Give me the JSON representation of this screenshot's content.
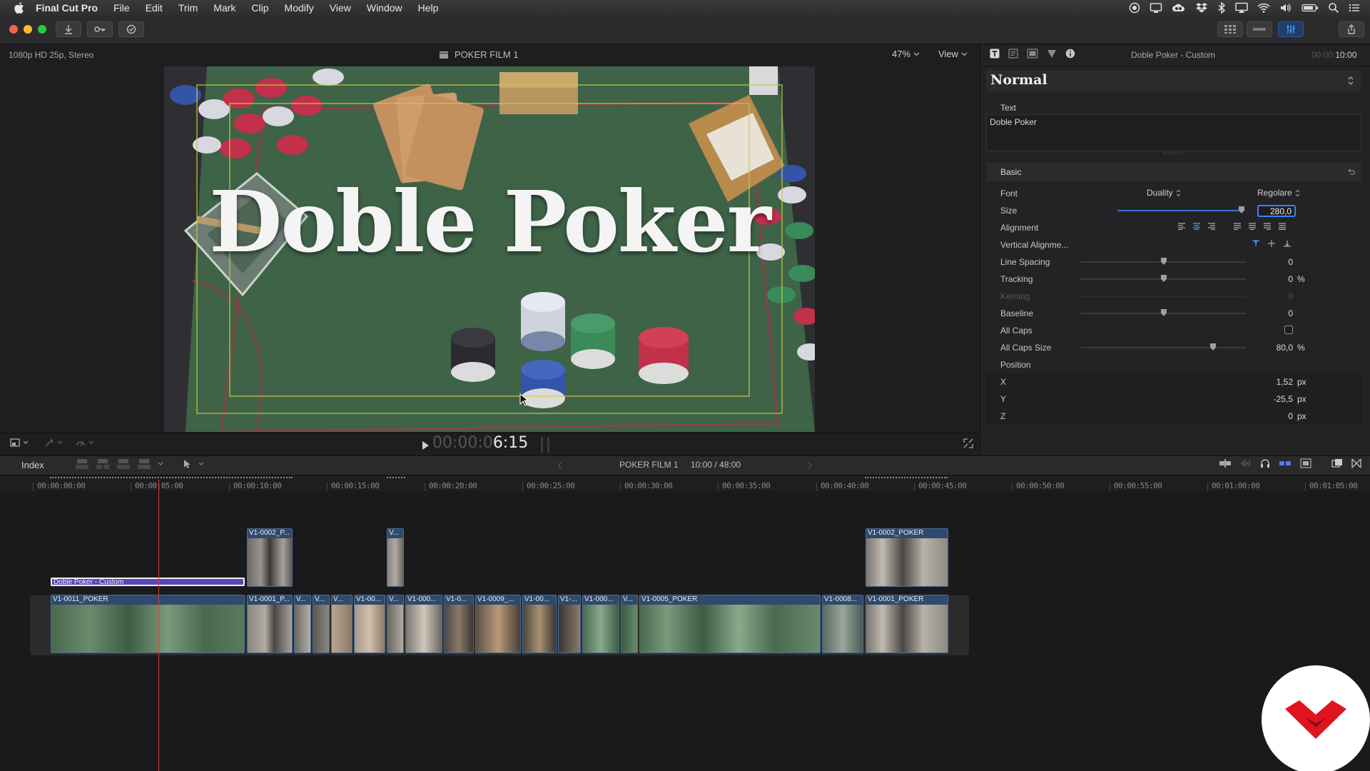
{
  "menubar": {
    "app_name": "Final Cut Pro",
    "items": [
      "File",
      "Edit",
      "Trim",
      "Mark",
      "Clip",
      "Modify",
      "View",
      "Window",
      "Help"
    ],
    "status_icons": [
      "record-icon",
      "display-icon",
      "creative-cloud-icon",
      "dropbox-icon",
      "bluetooth-icon",
      "airplay-icon",
      "wifi-icon",
      "volume-icon",
      "battery-icon",
      "spotlight-icon",
      "notification-center-icon"
    ]
  },
  "viewer": {
    "format": "1080p HD 25p, Stereo",
    "project_title": "POKER FILM 1",
    "zoom": "47%",
    "view_label": "View",
    "title_text": "Doble Poker",
    "timecode_dim": "00:00:0",
    "timecode_bright": "6:15"
  },
  "inspector": {
    "header_title": "Doble Poker - Custom",
    "header_time_dim": "00:00:",
    "header_time": "10:00",
    "style_preset": "Normal",
    "text_section_label": "Text",
    "text_value": "Doble Poker",
    "basic_label": "Basic",
    "rows": {
      "font_label": "Font",
      "font_value": "Duality",
      "font_style": "Regolare",
      "size_label": "Size",
      "size_value": "280,0",
      "alignment_label": "Alignment",
      "valign_label": "Vertical Alignme...",
      "line_spacing_label": "Line Spacing",
      "line_spacing_value": "0",
      "tracking_label": "Tracking",
      "tracking_value": "0",
      "tracking_unit": "%",
      "kerning_label": "Kerning",
      "kerning_value": "0",
      "baseline_label": "Baseline",
      "baseline_value": "0",
      "all_caps_label": "All Caps",
      "all_caps_size_label": "All Caps Size",
      "all_caps_size_value": "80,0",
      "all_caps_size_unit": "%",
      "position_label": "Position",
      "x_label": "X",
      "x_value": "1,52",
      "x_unit": "px",
      "y_label": "Y",
      "y_value": "-25,5",
      "y_unit": "px",
      "z_label": "Z",
      "z_value": "0",
      "z_unit": "px"
    }
  },
  "timeline": {
    "index_label": "Index",
    "project_name": "POKER FILM 1",
    "duration": "10:00 / 48:00",
    "ruler_ticks": [
      "00:00:00:00",
      "00:00:05:00",
      "00:00:10:00",
      "00:00:15:00",
      "00:00:20:00",
      "00:00:25:00",
      "00:00:30:00",
      "00:00:35:00",
      "00:00:40:00",
      "00:00:45:00",
      "00:00:50:00",
      "00:00:55:00",
      "00:01:00:00",
      "00:01:05:00"
    ],
    "title_clip": "Doble Poker - Custom",
    "connected_clips": [
      "V1-0002_P...",
      "V...",
      "V1-0002_POKER"
    ],
    "primary_clips": [
      "V1-0011_POKER",
      "V1-0001_P...",
      "V...",
      "V...",
      "V...",
      "V1-00...",
      "V...",
      "V1-000...",
      "V1-0...",
      "V1-0009_...",
      "V1-00...",
      "V1-...",
      "V1-000...",
      "V...",
      "V1-0005_POKER",
      "V1-0008...",
      "V1-0001_POKER"
    ]
  },
  "colors": {
    "accent_blue": "#3b82f6",
    "title_clip_purple": "#5a46b8",
    "playhead_red": "#d33a3a",
    "clip_blue": "#2f4a6c",
    "logo_red": "#e0141e"
  }
}
